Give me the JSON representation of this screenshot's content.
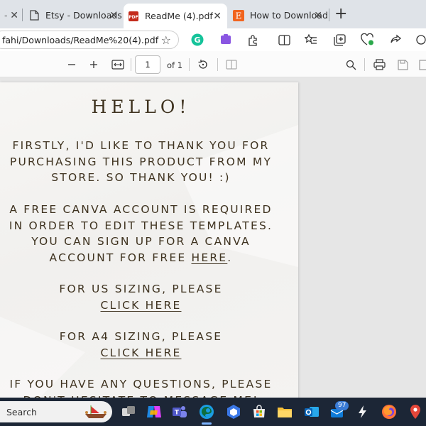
{
  "browser": {
    "tabs": [
      {
        "title": "- ",
        "favicon": "generic-icon"
      },
      {
        "title": "Etsy - Downloads",
        "favicon": "document-icon"
      },
      {
        "title": "ReadMe (4).pdf",
        "favicon": "pdf-icon",
        "active": true
      },
      {
        "title": "How to Download",
        "favicon": "etsy-icon"
      }
    ],
    "new_tab_label": "+",
    "close_glyph": "✕",
    "address_url": "fahi/Downloads/ReadMe%20(4).pdf"
  },
  "pdf_toolbar": {
    "page_number": "1",
    "page_total": "of 1"
  },
  "document": {
    "heading": "HELLO!",
    "para1": [
      "FIRSTLY, I'D LIKE TO THANK YOU FOR",
      "PURCHASING THIS PRODUCT FROM MY",
      "STORE. SO THANK YOU! :)"
    ],
    "para2_lines": [
      "A FREE CANVA ACCOUNT IS REQUIRED",
      "IN ORDER TO EDIT THESE TEMPLATES.",
      "YOU CAN SIGN UP FOR A CANVA"
    ],
    "para2_last_prefix": "ACCOUNT FOR FREE ",
    "para2_link": "HERE",
    "para2_last_suffix": ".",
    "us_sizing": "FOR US SIZING, PLEASE",
    "us_link": "CLICK HERE",
    "a4_sizing": "FOR A4 SIZING, PLEASE",
    "a4_link": "CLICK HERE",
    "questions_line1": "IF YOU HAVE ANY QUESTIONS, PLEASE",
    "questions_line2": "DON'T HESITATE TO MESSAGE ME!"
  },
  "taskbar": {
    "search_placeholder": "Search",
    "mail_badge": "97"
  },
  "colors": {
    "doc_text": "#3f3320",
    "taskbar": "#1c2636",
    "tabstrip": "#dfe3e8"
  }
}
